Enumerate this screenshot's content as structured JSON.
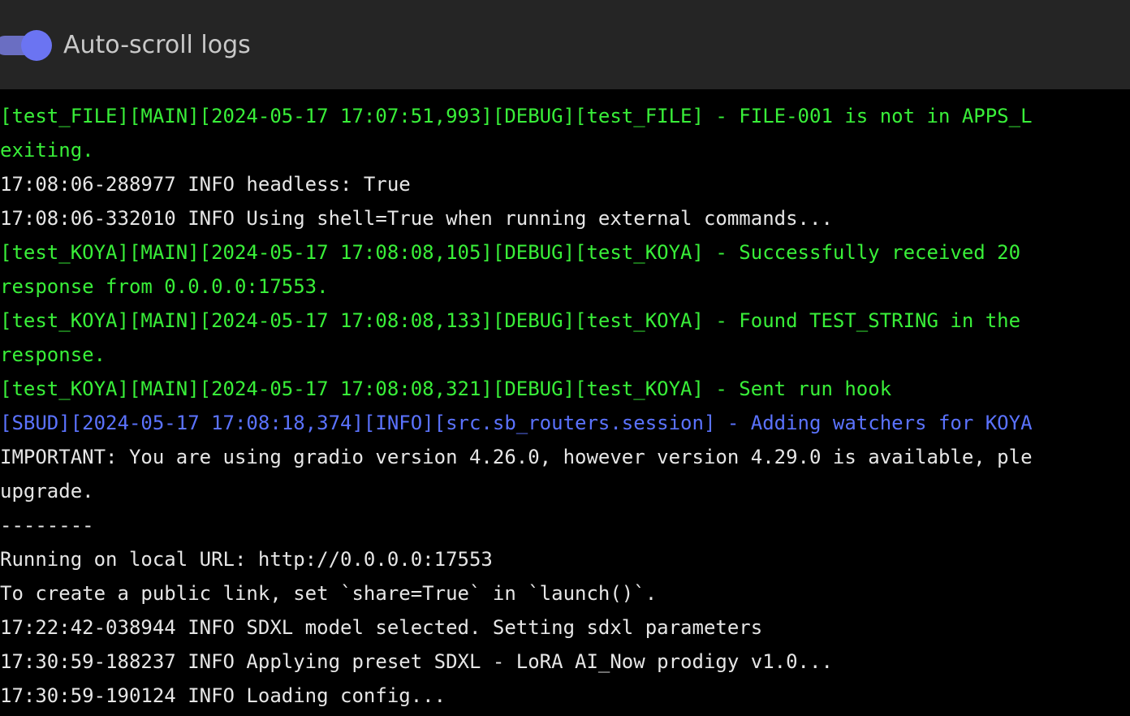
{
  "toolbar": {
    "autoscroll_label": "Auto-scroll logs",
    "autoscroll_on": true,
    "toggle_color": "#6b74f2"
  },
  "colors": {
    "green": "#39ef39",
    "blue": "#5b73ff",
    "white": "#e6e6e6",
    "header_bg": "#252525",
    "log_bg": "#000000"
  },
  "logs": [
    {
      "text": "[test_FILE][MAIN][2024-05-17 17:07:51,993][DEBUG][test_FILE] - FILE-001 is not in APPS_L",
      "color": "green"
    },
    {
      "text": "exiting.",
      "color": "green"
    },
    {
      "text": "17:08:06-288977 INFO headless: True",
      "color": "white"
    },
    {
      "text": "17:08:06-332010 INFO Using shell=True when running external commands...",
      "color": "white"
    },
    {
      "text": "[test_KOYA][MAIN][2024-05-17 17:08:08,105][DEBUG][test_KOYA] - Successfully received 20",
      "color": "green"
    },
    {
      "text": "response from 0.0.0.0:17553.",
      "color": "green"
    },
    {
      "text": "[test_KOYA][MAIN][2024-05-17 17:08:08,133][DEBUG][test_KOYA] - Found TEST_STRING in the",
      "color": "green"
    },
    {
      "text": "response.",
      "color": "green"
    },
    {
      "text": "[test_KOYA][MAIN][2024-05-17 17:08:08,321][DEBUG][test_KOYA] - Sent run hook",
      "color": "green"
    },
    {
      "text": "[SBUD][2024-05-17 17:08:18,374][INFO][src.sb_routers.session] - Adding watchers for KOYA",
      "color": "blue"
    },
    {
      "text": "IMPORTANT: You are using gradio version 4.26.0, however version 4.29.0 is available, ple",
      "color": "white"
    },
    {
      "text": "upgrade.",
      "color": "white"
    },
    {
      "text": "--------",
      "color": "white"
    },
    {
      "text": "Running on local URL: http://0.0.0.0:17553",
      "color": "white"
    },
    {
      "text": "To create a public link, set `share=True` in `launch()`.",
      "color": "white"
    },
    {
      "text": "17:22:42-038944 INFO SDXL model selected. Setting sdxl parameters",
      "color": "white"
    },
    {
      "text": "17:30:59-188237 INFO Applying preset SDXL - LoRA AI_Now prodigy v1.0...",
      "color": "white"
    },
    {
      "text": "17:30:59-190124 INFO Loading config...",
      "color": "white"
    }
  ]
}
